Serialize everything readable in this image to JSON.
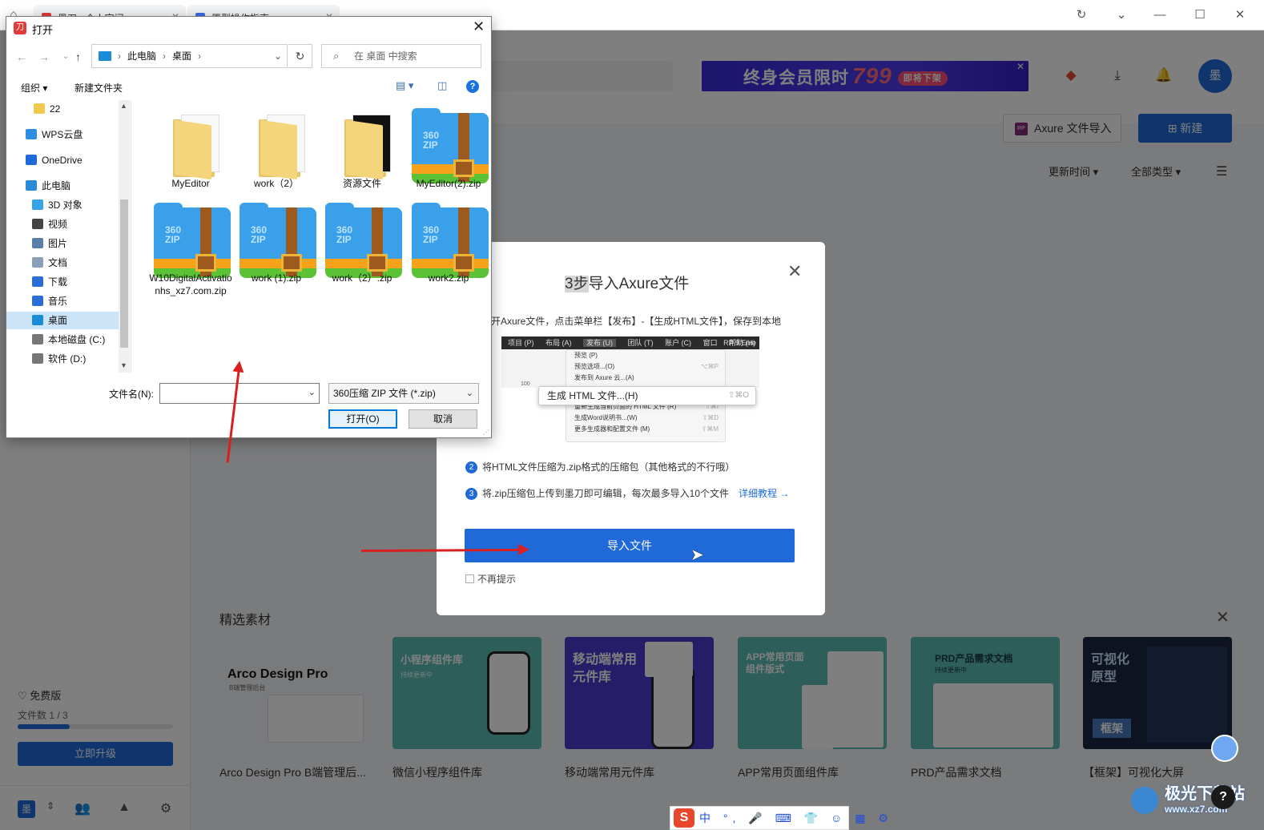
{
  "browser": {
    "tabs": [
      {
        "label": "墨刀 - 个人空间"
      },
      {
        "label": "原型操作指南"
      }
    ]
  },
  "header": {
    "banner_text": "终身会员限时",
    "banner_price": "799",
    "banner_tag": "即将下架",
    "avatar_text": "墨"
  },
  "actions": {
    "axure_import_label": "Axure 文件导入",
    "new_label": "新建",
    "sort_time": "更新时间",
    "filter_type": "全部类型"
  },
  "sidebar": {
    "plan": "免费版",
    "files_label": "文件数",
    "files_count": "1 / 3",
    "files_progress": 0.333,
    "upgrade_label": "立即升级",
    "logo_text": "墨"
  },
  "materials": {
    "title": "精选素材",
    "cards": [
      {
        "label": "Arco Design Pro B端管理后...",
        "thumb_title": "Arco Design Pro",
        "thumb_sub": "B端管理后台"
      },
      {
        "label": "微信小程序组件库",
        "thumb_title": "小程序组件库",
        "thumb_sub": "持续更新中"
      },
      {
        "label": "移动端常用元件库",
        "thumb_title": "移动端常用\n元件库"
      },
      {
        "label": "APP常用页面组件库",
        "thumb_title": "APP常用页面\n组件版式"
      },
      {
        "label": "PRD产品需求文档",
        "thumb_title": "PRD产品需求文档",
        "thumb_sub": "持续更新中"
      },
      {
        "label": "【框架】可视化大屏",
        "thumb_title": "可视化\n原型",
        "thumb_sub": "框架"
      }
    ]
  },
  "modal": {
    "title_prefix": "3步",
    "title_rest": "导入Axure文件",
    "step1": "开Axure文件，点击菜单栏【发布】-【生成HTML文件】，保存到本地",
    "step2_num": "2",
    "step2": "将HTML文件压缩为.zip格式的压缩包（其他格式的不行哦）",
    "step3_num": "3",
    "step3": "将.zip压缩包上传到墨刀即可编辑，每次最多导入10个文件",
    "tutorial_link": "详细教程 →",
    "import_button": "导入文件",
    "no_show": "不再提示",
    "menu": {
      "bar": [
        "项目 (P)",
        "布局 (A)",
        "发布 (U)",
        "团队 (T)",
        "账户 (C)",
        "窗口",
        "帮助 (H)"
      ],
      "bar_right": "RP 9 Ente",
      "items": [
        {
          "label": "预览 (P)",
          "shortcut": ""
        },
        {
          "label": "预览选项...(O)",
          "shortcut": "⌥⌘P"
        },
        {
          "label": "发布到 Axure 云...(A)",
          "shortcut": ""
        },
        {
          "label": "",
          "shortcut": ""
        },
        {
          "label": "重新生成当前页面的 HTML 文件 (R)",
          "shortcut": "⇧⌘I"
        },
        {
          "label": "生成Word说明书...(W)",
          "shortcut": "⇧⌘D"
        },
        {
          "label": "更多生成器和配置文件 (M)",
          "shortcut": "⇧⌘M"
        }
      ],
      "popup_label": "生成 HTML 文件...(H)",
      "popup_shortcut": "⇧⌘O",
      "ruler_num": "100"
    }
  },
  "dialog": {
    "title": "打开",
    "breadcrumb": [
      "此电脑",
      "桌面"
    ],
    "search_placeholder": "在 桌面 中搜索",
    "organize": "组织 ▾",
    "new_folder": "新建文件夹",
    "nav": [
      {
        "label": "22",
        "icon": "folder-icon"
      },
      {
        "label": "WPS云盘",
        "icon": "cloud-icon"
      },
      {
        "label": "OneDrive",
        "icon": "onedrive-icon"
      },
      {
        "label": "此电脑",
        "icon": "computer-icon"
      },
      {
        "label": "3D 对象",
        "icon": "cube-icon"
      },
      {
        "label": "视频",
        "icon": "video-icon"
      },
      {
        "label": "图片",
        "icon": "picture-icon"
      },
      {
        "label": "文档",
        "icon": "document-icon"
      },
      {
        "label": "下载",
        "icon": "download-icon"
      },
      {
        "label": "音乐",
        "icon": "music-icon"
      },
      {
        "label": "桌面",
        "icon": "desktop-icon"
      },
      {
        "label": "本地磁盘 (C:)",
        "icon": "drive-icon"
      },
      {
        "label": "软件 (D:)",
        "icon": "drive-icon"
      }
    ],
    "files": [
      {
        "label": "MyEditor",
        "type": "folder"
      },
      {
        "label": "work（2）",
        "type": "folder"
      },
      {
        "label": "资源文件",
        "type": "folder"
      },
      {
        "label": "MyEditor(2).zip",
        "type": "zip"
      },
      {
        "label": "W10DigitalActivationhs_xz7.com.zip",
        "type": "zip"
      },
      {
        "label": "work (1).zip",
        "type": "zip"
      },
      {
        "label": "work（2）.zip",
        "type": "zip"
      },
      {
        "label": "work2.zip",
        "type": "zip"
      }
    ],
    "zip_badge_line1": "360",
    "zip_badge_line2": "ZIP",
    "filename_label": "文件名(N):",
    "filename_value": "",
    "filetype": "360压缩 ZIP 文件 (*.zip)",
    "open_button": "打开(O)",
    "cancel_button": "取消"
  },
  "ime": {
    "logo": "S",
    "text": "中 °, 🎤 ⌨ 👕 ☺ ▦ ⚙"
  },
  "watermark": {
    "title": "极光下载站",
    "sub": "www.xz7.com"
  },
  "colors": {
    "primary": "#1f6ad8",
    "arrow": "#d92020",
    "banner": "#4f3cf2"
  }
}
